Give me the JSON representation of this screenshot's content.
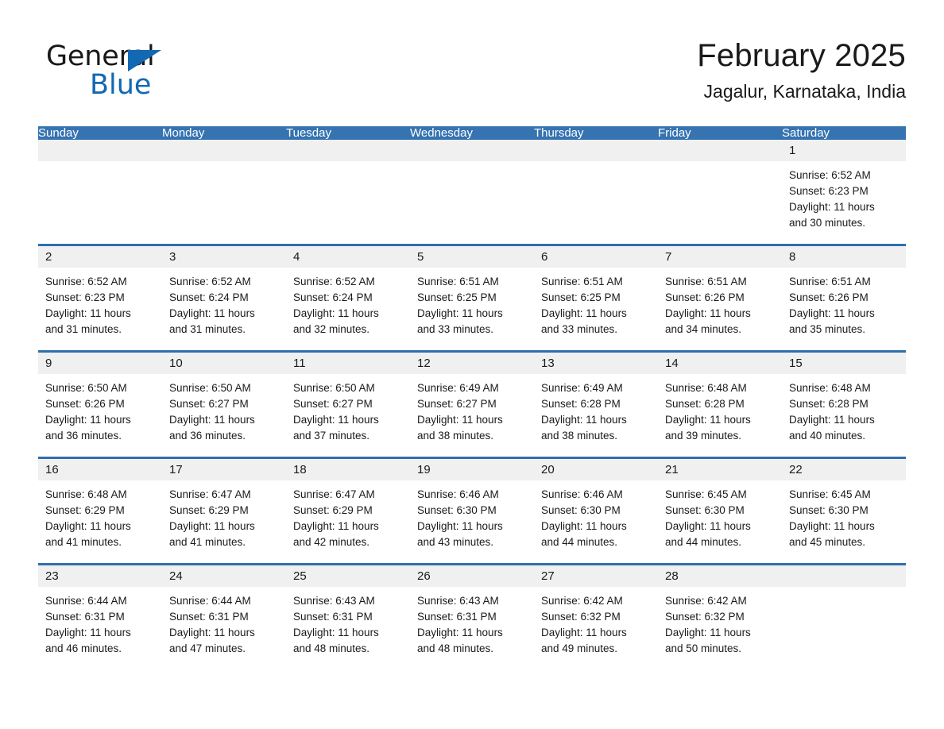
{
  "logo": {
    "word_one": "General",
    "word_two": "Blue",
    "triangle_icon": "triangle-icon",
    "brand_color": "#1268b3"
  },
  "header": {
    "title": "February 2025",
    "subtitle": "Jagalur, Karnataka, India"
  },
  "colors": {
    "header_blue": "#3573b1",
    "row_divider_blue": "#2f6fae",
    "daynum_band": "#f0f0f0",
    "text": "#1a1a1a"
  },
  "weekdays": [
    "Sunday",
    "Monday",
    "Tuesday",
    "Wednesday",
    "Thursday",
    "Friday",
    "Saturday"
  ],
  "weeks": [
    [
      {
        "day": "",
        "sunrise": "",
        "sunset": "",
        "daylight_line1": "",
        "daylight_line2": ""
      },
      {
        "day": "",
        "sunrise": "",
        "sunset": "",
        "daylight_line1": "",
        "daylight_line2": ""
      },
      {
        "day": "",
        "sunrise": "",
        "sunset": "",
        "daylight_line1": "",
        "daylight_line2": ""
      },
      {
        "day": "",
        "sunrise": "",
        "sunset": "",
        "daylight_line1": "",
        "daylight_line2": ""
      },
      {
        "day": "",
        "sunrise": "",
        "sunset": "",
        "daylight_line1": "",
        "daylight_line2": ""
      },
      {
        "day": "",
        "sunrise": "",
        "sunset": "",
        "daylight_line1": "",
        "daylight_line2": ""
      },
      {
        "day": "1",
        "sunrise": "Sunrise: 6:52 AM",
        "sunset": "Sunset: 6:23 PM",
        "daylight_line1": "Daylight: 11 hours",
        "daylight_line2": "and 30 minutes."
      }
    ],
    [
      {
        "day": "2",
        "sunrise": "Sunrise: 6:52 AM",
        "sunset": "Sunset: 6:23 PM",
        "daylight_line1": "Daylight: 11 hours",
        "daylight_line2": "and 31 minutes."
      },
      {
        "day": "3",
        "sunrise": "Sunrise: 6:52 AM",
        "sunset": "Sunset: 6:24 PM",
        "daylight_line1": "Daylight: 11 hours",
        "daylight_line2": "and 31 minutes."
      },
      {
        "day": "4",
        "sunrise": "Sunrise: 6:52 AM",
        "sunset": "Sunset: 6:24 PM",
        "daylight_line1": "Daylight: 11 hours",
        "daylight_line2": "and 32 minutes."
      },
      {
        "day": "5",
        "sunrise": "Sunrise: 6:51 AM",
        "sunset": "Sunset: 6:25 PM",
        "daylight_line1": "Daylight: 11 hours",
        "daylight_line2": "and 33 minutes."
      },
      {
        "day": "6",
        "sunrise": "Sunrise: 6:51 AM",
        "sunset": "Sunset: 6:25 PM",
        "daylight_line1": "Daylight: 11 hours",
        "daylight_line2": "and 33 minutes."
      },
      {
        "day": "7",
        "sunrise": "Sunrise: 6:51 AM",
        "sunset": "Sunset: 6:26 PM",
        "daylight_line1": "Daylight: 11 hours",
        "daylight_line2": "and 34 minutes."
      },
      {
        "day": "8",
        "sunrise": "Sunrise: 6:51 AM",
        "sunset": "Sunset: 6:26 PM",
        "daylight_line1": "Daylight: 11 hours",
        "daylight_line2": "and 35 minutes."
      }
    ],
    [
      {
        "day": "9",
        "sunrise": "Sunrise: 6:50 AM",
        "sunset": "Sunset: 6:26 PM",
        "daylight_line1": "Daylight: 11 hours",
        "daylight_line2": "and 36 minutes."
      },
      {
        "day": "10",
        "sunrise": "Sunrise: 6:50 AM",
        "sunset": "Sunset: 6:27 PM",
        "daylight_line1": "Daylight: 11 hours",
        "daylight_line2": "and 36 minutes."
      },
      {
        "day": "11",
        "sunrise": "Sunrise: 6:50 AM",
        "sunset": "Sunset: 6:27 PM",
        "daylight_line1": "Daylight: 11 hours",
        "daylight_line2": "and 37 minutes."
      },
      {
        "day": "12",
        "sunrise": "Sunrise: 6:49 AM",
        "sunset": "Sunset: 6:27 PM",
        "daylight_line1": "Daylight: 11 hours",
        "daylight_line2": "and 38 minutes."
      },
      {
        "day": "13",
        "sunrise": "Sunrise: 6:49 AM",
        "sunset": "Sunset: 6:28 PM",
        "daylight_line1": "Daylight: 11 hours",
        "daylight_line2": "and 38 minutes."
      },
      {
        "day": "14",
        "sunrise": "Sunrise: 6:48 AM",
        "sunset": "Sunset: 6:28 PM",
        "daylight_line1": "Daylight: 11 hours",
        "daylight_line2": "and 39 minutes."
      },
      {
        "day": "15",
        "sunrise": "Sunrise: 6:48 AM",
        "sunset": "Sunset: 6:28 PM",
        "daylight_line1": "Daylight: 11 hours",
        "daylight_line2": "and 40 minutes."
      }
    ],
    [
      {
        "day": "16",
        "sunrise": "Sunrise: 6:48 AM",
        "sunset": "Sunset: 6:29 PM",
        "daylight_line1": "Daylight: 11 hours",
        "daylight_line2": "and 41 minutes."
      },
      {
        "day": "17",
        "sunrise": "Sunrise: 6:47 AM",
        "sunset": "Sunset: 6:29 PM",
        "daylight_line1": "Daylight: 11 hours",
        "daylight_line2": "and 41 minutes."
      },
      {
        "day": "18",
        "sunrise": "Sunrise: 6:47 AM",
        "sunset": "Sunset: 6:29 PM",
        "daylight_line1": "Daylight: 11 hours",
        "daylight_line2": "and 42 minutes."
      },
      {
        "day": "19",
        "sunrise": "Sunrise: 6:46 AM",
        "sunset": "Sunset: 6:30 PM",
        "daylight_line1": "Daylight: 11 hours",
        "daylight_line2": "and 43 minutes."
      },
      {
        "day": "20",
        "sunrise": "Sunrise: 6:46 AM",
        "sunset": "Sunset: 6:30 PM",
        "daylight_line1": "Daylight: 11 hours",
        "daylight_line2": "and 44 minutes."
      },
      {
        "day": "21",
        "sunrise": "Sunrise: 6:45 AM",
        "sunset": "Sunset: 6:30 PM",
        "daylight_line1": "Daylight: 11 hours",
        "daylight_line2": "and 44 minutes."
      },
      {
        "day": "22",
        "sunrise": "Sunrise: 6:45 AM",
        "sunset": "Sunset: 6:30 PM",
        "daylight_line1": "Daylight: 11 hours",
        "daylight_line2": "and 45 minutes."
      }
    ],
    [
      {
        "day": "23",
        "sunrise": "Sunrise: 6:44 AM",
        "sunset": "Sunset: 6:31 PM",
        "daylight_line1": "Daylight: 11 hours",
        "daylight_line2": "and 46 minutes."
      },
      {
        "day": "24",
        "sunrise": "Sunrise: 6:44 AM",
        "sunset": "Sunset: 6:31 PM",
        "daylight_line1": "Daylight: 11 hours",
        "daylight_line2": "and 47 minutes."
      },
      {
        "day": "25",
        "sunrise": "Sunrise: 6:43 AM",
        "sunset": "Sunset: 6:31 PM",
        "daylight_line1": "Daylight: 11 hours",
        "daylight_line2": "and 48 minutes."
      },
      {
        "day": "26",
        "sunrise": "Sunrise: 6:43 AM",
        "sunset": "Sunset: 6:31 PM",
        "daylight_line1": "Daylight: 11 hours",
        "daylight_line2": "and 48 minutes."
      },
      {
        "day": "27",
        "sunrise": "Sunrise: 6:42 AM",
        "sunset": "Sunset: 6:32 PM",
        "daylight_line1": "Daylight: 11 hours",
        "daylight_line2": "and 49 minutes."
      },
      {
        "day": "28",
        "sunrise": "Sunrise: 6:42 AM",
        "sunset": "Sunset: 6:32 PM",
        "daylight_line1": "Daylight: 11 hours",
        "daylight_line2": "and 50 minutes."
      },
      {
        "day": "",
        "sunrise": "",
        "sunset": "",
        "daylight_line1": "",
        "daylight_line2": ""
      }
    ]
  ]
}
